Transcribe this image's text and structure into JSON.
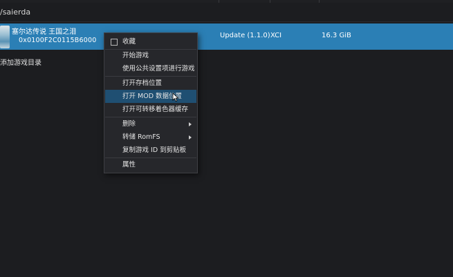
{
  "path": "/saierda",
  "game": {
    "title": "塞尔达传说 王国之泪",
    "id": "0x0100F2C0115B6000",
    "version": "Update (1.1.0)",
    "format": "XCI",
    "size": "16.3 GiB",
    "icon": "game-icon"
  },
  "add_dir_label": "添加游戏目录",
  "menu": {
    "favorite": "收藏",
    "start": "开始游戏",
    "start_global": "使用公共设置项进行游戏",
    "open_save": "打开存档位置",
    "open_mod": "打开 MOD 数据位置",
    "open_shader": "打开可转移着色器缓存",
    "delete": "删除",
    "dump_romfs": "转储 RomFS",
    "copy_id": "复制游戏 ID 到剪贴板",
    "properties": "属性"
  },
  "colors": {
    "row_selected": "#2b7fb5",
    "menu_highlight": "#1f4f72",
    "background": "#1c1d20"
  }
}
